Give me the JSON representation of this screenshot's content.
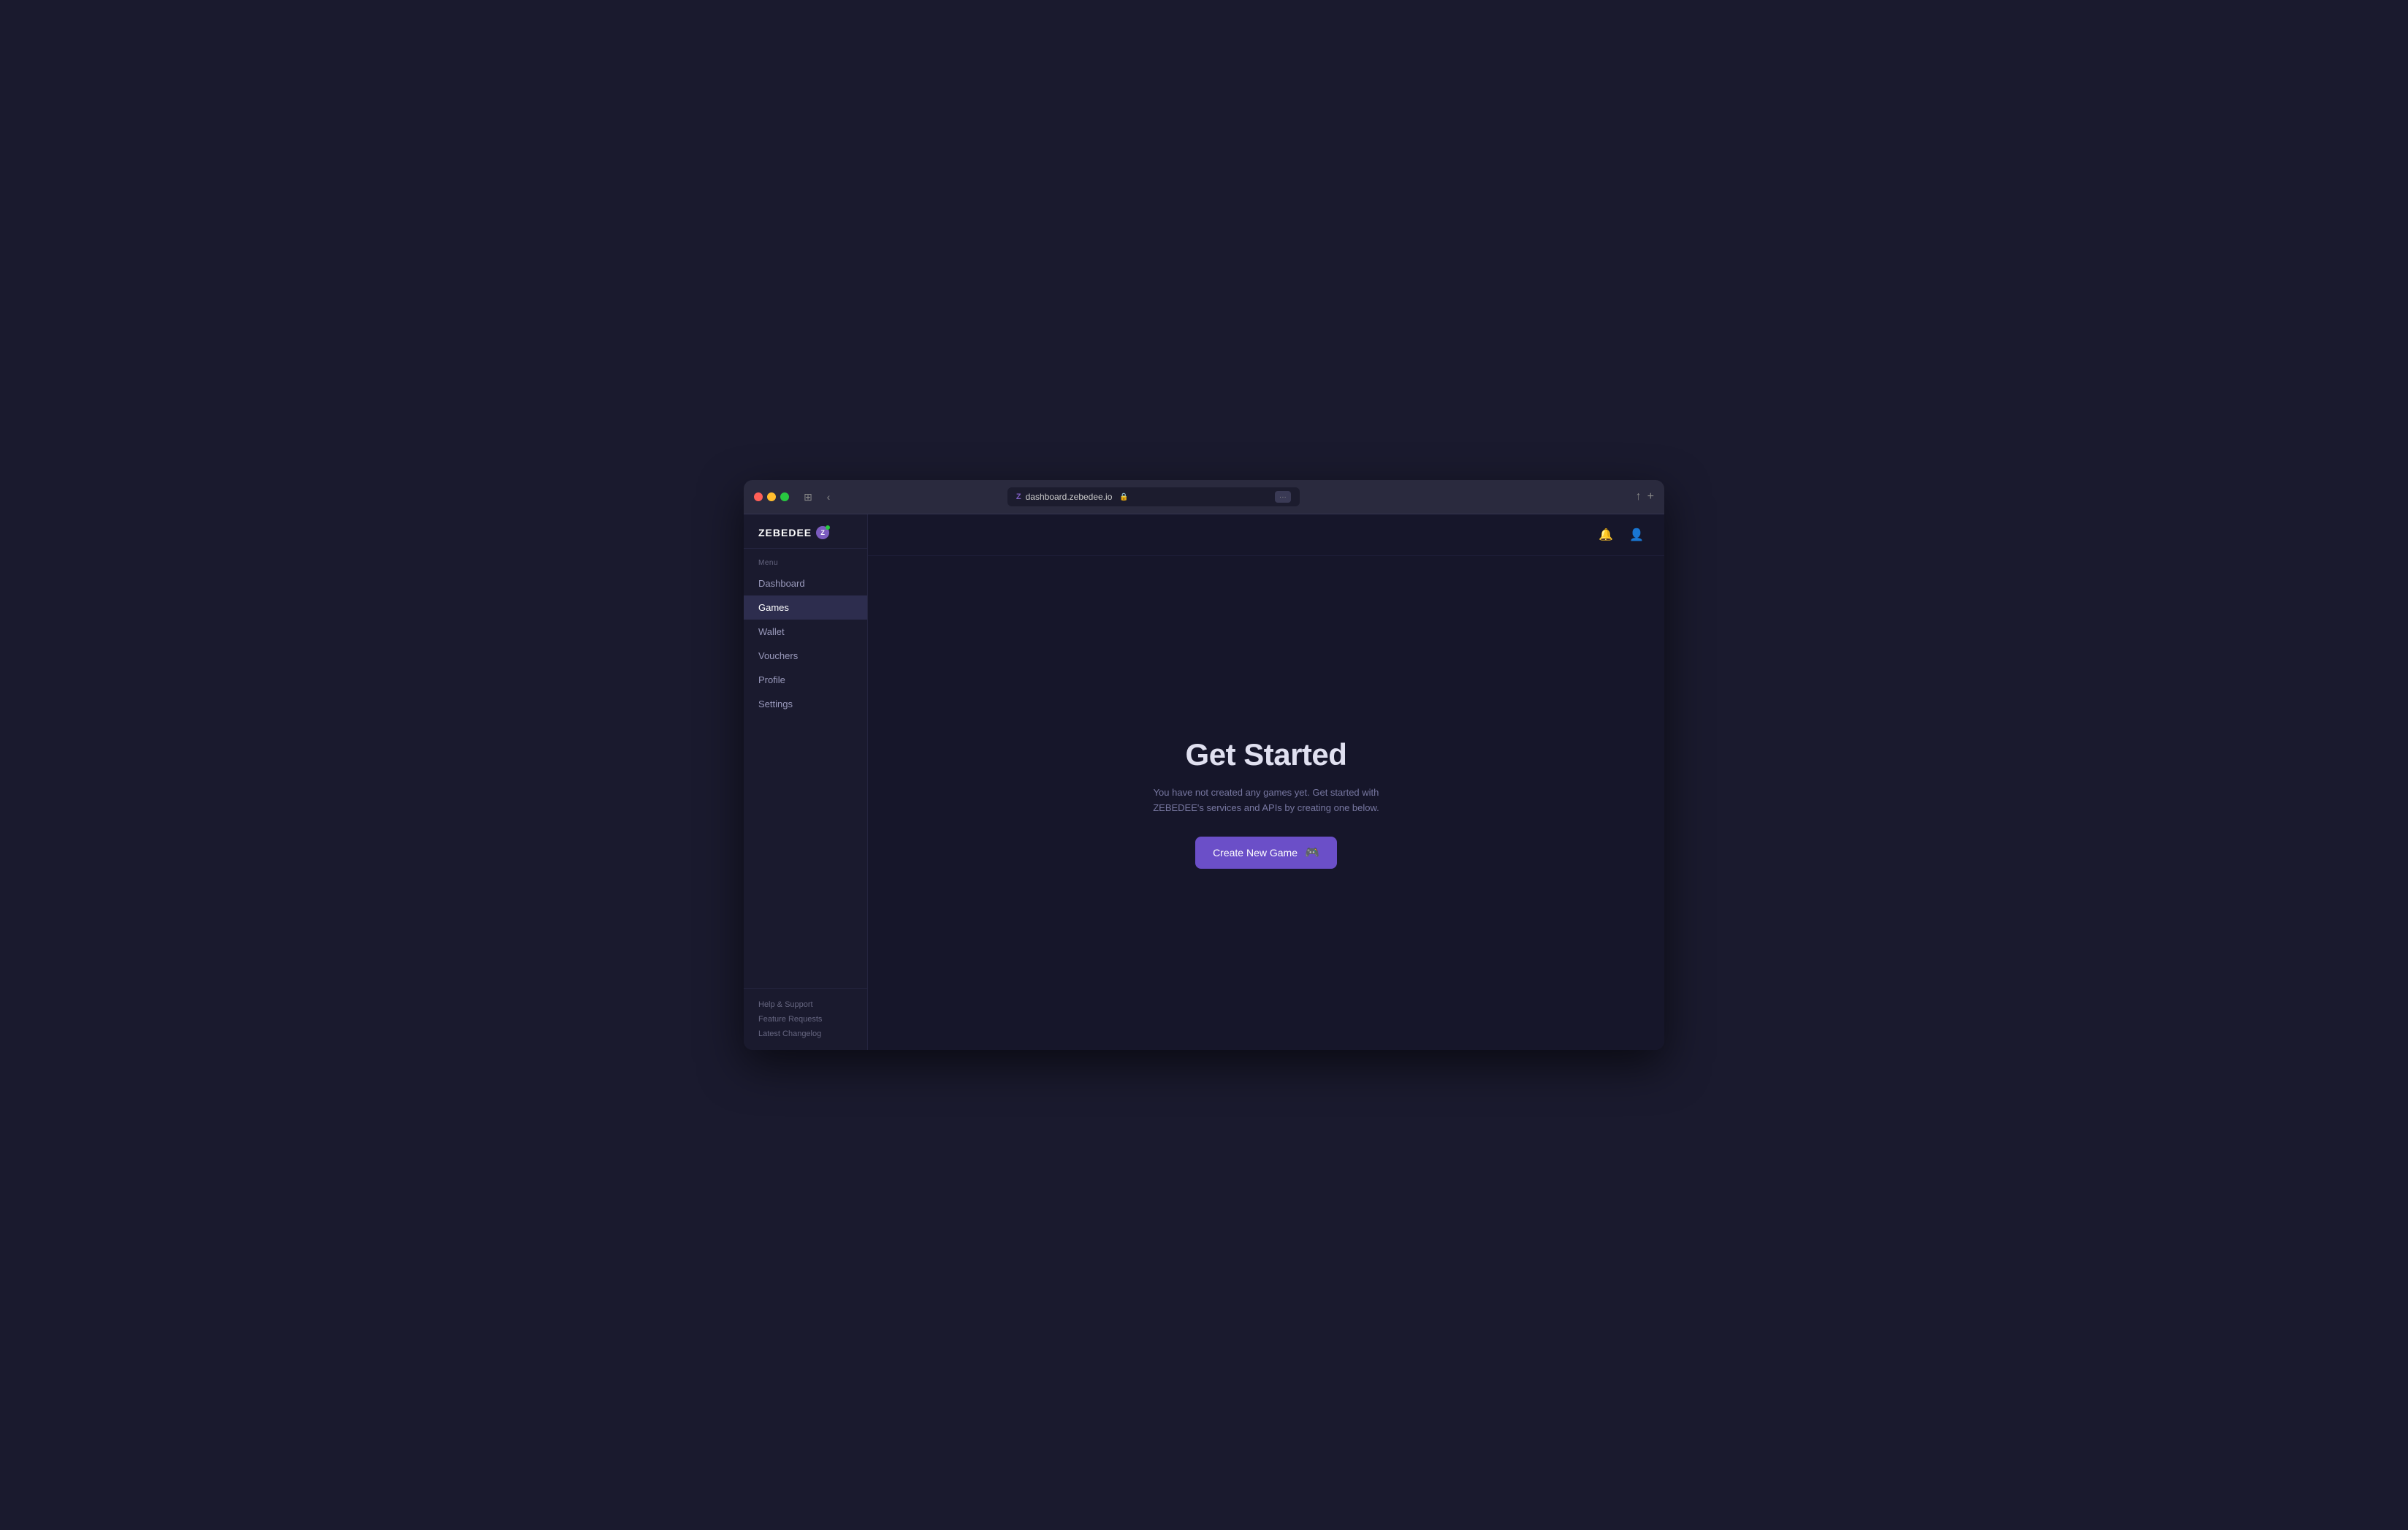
{
  "browser": {
    "url": "dashboard.zebedee.io",
    "favicon": "Z"
  },
  "sidebar": {
    "logo": "ZEBEDEE",
    "menu_label": "Menu",
    "nav_items": [
      {
        "id": "dashboard",
        "label": "Dashboard",
        "active": false
      },
      {
        "id": "games",
        "label": "Games",
        "active": true
      },
      {
        "id": "wallet",
        "label": "Wallet",
        "active": false
      },
      {
        "id": "vouchers",
        "label": "Vouchers",
        "active": false
      },
      {
        "id": "profile",
        "label": "Profile",
        "active": false
      },
      {
        "id": "settings",
        "label": "Settings",
        "active": false
      }
    ],
    "footer_links": [
      {
        "id": "help",
        "label": "Help & Support"
      },
      {
        "id": "feature",
        "label": "Feature Requests"
      },
      {
        "id": "changelog",
        "label": "Latest Changelog"
      }
    ]
  },
  "main": {
    "title": "Get Started",
    "description_line1": "You have not created any games yet. Get started with",
    "description_line2": "ZEBEDEE's services and APIs by creating one below.",
    "create_button_label": "Create New Game"
  },
  "icons": {
    "bell": "🔔",
    "user": "👤",
    "gamepad": "🎮",
    "sidebar_toggle": "⊞",
    "back": "‹",
    "share": "↑",
    "new_tab": "+"
  }
}
